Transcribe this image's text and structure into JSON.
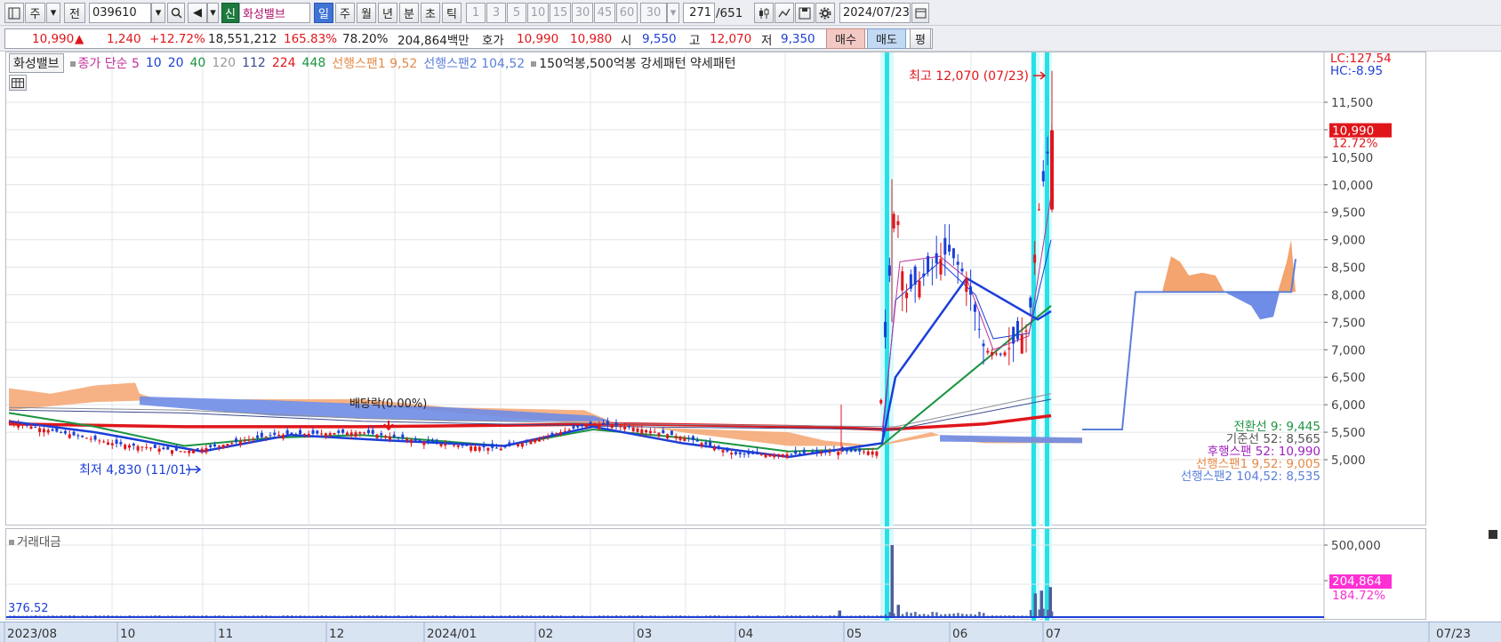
{
  "toolbar": {
    "market": "주",
    "prev": "전",
    "code": "039610",
    "new_badge": "신",
    "stock_name": "화성밸브",
    "periods": [
      "일",
      "주",
      "월",
      "년",
      "분",
      "초",
      "틱"
    ],
    "minutes": [
      "1",
      "3",
      "5",
      "10",
      "15",
      "30",
      "45",
      "60"
    ],
    "count_select": "30",
    "page_current": "271",
    "page_total": "/651",
    "date": "2024/07/23"
  },
  "quote": {
    "price": "10,990",
    "arrow": "▲",
    "change": "1,240",
    "change_pct": "+12.72%",
    "volume": "18,551,212",
    "vol_ratio": "165.83%",
    "turnover": "78.20%",
    "amount": "204,864백만",
    "hoga_label": "호가",
    "ask": "10,990",
    "bid": "10,980",
    "open_label": "시",
    "open": "9,550",
    "high_label": "고",
    "high": "12,070",
    "low_label": "저",
    "low": "9,350",
    "buy": "매수",
    "sell": "매도",
    "eval": "평"
  },
  "legend": {
    "title": "화성밸브",
    "ma_label": "종가 단순 5",
    "ma10": "10",
    "ma20": "20",
    "ma40": "40",
    "ma120": "120",
    "ma112": "112",
    "ma224": "224",
    "ma448": "448",
    "span1": "선행스팬1 9,52",
    "span2": "선행스팬2 104,52",
    "patterns": "150억봉,500억봉 강세패턴  약세패턴"
  },
  "annotations": {
    "high": "최고 12,070 (07/23)",
    "low": "최저 4,830 (11/01)",
    "dividend": "배당락(0.00%)",
    "lc": "LC:127.54",
    "hc": "HC:-8.95",
    "last_price": "10,990",
    "last_pct": "12.72%",
    "conv": "전환선 9: 9,445",
    "base": "기준선 52: 8,565",
    "lag": "후행스팬 52: 10,990",
    "lead1": "선행스팬1 9,52: 9,005",
    "lead2": "선행스팬2 104,52: 8,535"
  },
  "price_axis": [
    "11,500",
    "11,000",
    "10,500",
    "10,000",
    "9,500",
    "9,000",
    "8,500",
    "8,000",
    "7,500",
    "7,000",
    "6,500",
    "6,000",
    "5,500",
    "5,000"
  ],
  "volume_panel": {
    "title": "거래대금",
    "left_value": "376.52",
    "axis": [
      "500,000",
      "250,000"
    ],
    "last_value": "204,864",
    "last_pct": "184.72%"
  },
  "date_axis": [
    "2023/08",
    "10",
    "11",
    "12",
    "2024/01",
    "02",
    "03",
    "04",
    "05",
    "06",
    "07",
    "07/23"
  ],
  "colors": {
    "up": "#e0161b",
    "down": "#1b3fd8",
    "cloud_up": "#f4a46e",
    "cloud_down": "#6f8ce6",
    "highlight": "#28e0e8"
  },
  "chart_data": {
    "type": "candlestick",
    "series": [
      {
        "name": "종가 단순 5",
        "values": [
          5700,
          5400,
          5300,
          5350,
          5500,
          5400,
          5600,
          5450,
          5350,
          5200,
          5250,
          6300,
          8300,
          8700,
          8300,
          7000,
          7200,
          7600,
          9500,
          10990
        ]
      },
      {
        "name": "거래대금",
        "values": [
          376.52,
          204864
        ]
      }
    ],
    "x": [
      "2023/08",
      "10",
      "11",
      "12",
      "2024/01",
      "02",
      "03",
      "04",
      "05",
      "06",
      "07",
      "07/23"
    ],
    "ylim": [
      4830,
      12070
    ]
  }
}
